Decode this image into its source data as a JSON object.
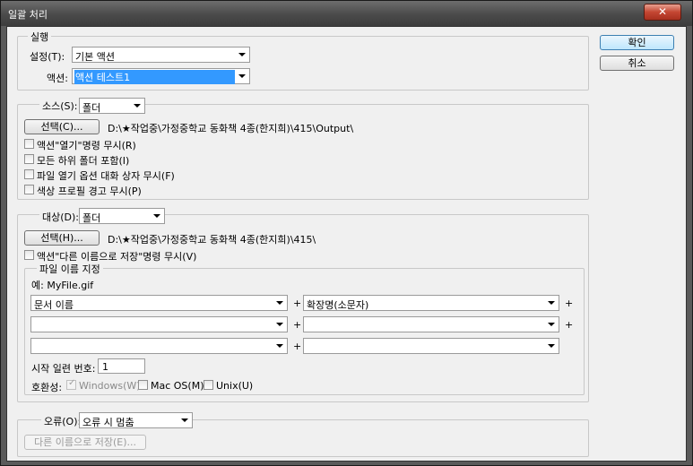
{
  "window": {
    "title": "일괄 처리",
    "close_label": "✕"
  },
  "buttons": {
    "ok": "확인",
    "cancel": "취소"
  },
  "run": {
    "group_label": "실행",
    "set_label": "설정(T):",
    "set_value": "기본 액션",
    "action_label": "액션:",
    "action_value": "액션 테스트1"
  },
  "source": {
    "label": "소스(S):",
    "value": "폴더",
    "choose_button": "선택(C)...",
    "path": "D:\\★작업중\\가정중학교 동화책 4종(한지희)\\415\\Output\\",
    "options": [
      {
        "label": "액션\"열기\"명령 무시(R)",
        "checked": false
      },
      {
        "label": "모든 하위 폴더 포함(I)",
        "checked": false
      },
      {
        "label": "파일 열기 옵션 대화 상자 무시(F)",
        "checked": false
      },
      {
        "label": "색상 프로필 경고 무시(P)",
        "checked": false
      }
    ]
  },
  "destination": {
    "label": "대상(D):",
    "value": "폴더",
    "choose_button": "선택(H)...",
    "path": "D:\\★작업중\\가정중학교 동화책 4종(한지희)\\415\\",
    "override_label": "액션\"다른 이름으로 저장\"명령 무시(V)",
    "override_checked": false
  },
  "naming": {
    "group_label": "파일 이름 지정",
    "example": "예: MyFile.gif",
    "fields": [
      {
        "left": "문서 이름",
        "right": "확장명(소문자)"
      },
      {
        "left": "",
        "right": ""
      },
      {
        "left": "",
        "right": ""
      }
    ],
    "plus": "+",
    "serial_label": "시작 일련 번호:",
    "serial_value": "1",
    "compat_label": "호환성:",
    "compat": [
      {
        "label": "Windows(W)",
        "checked": true,
        "disabled": true
      },
      {
        "label": "Mac OS(M)",
        "checked": false,
        "disabled": false
      },
      {
        "label": "Unix(U)",
        "checked": false,
        "disabled": false
      }
    ]
  },
  "errors": {
    "label": "오류(O):",
    "value": "오류 시 멈춤",
    "save_as_button": "다른 이름으로 저장(E)..."
  }
}
